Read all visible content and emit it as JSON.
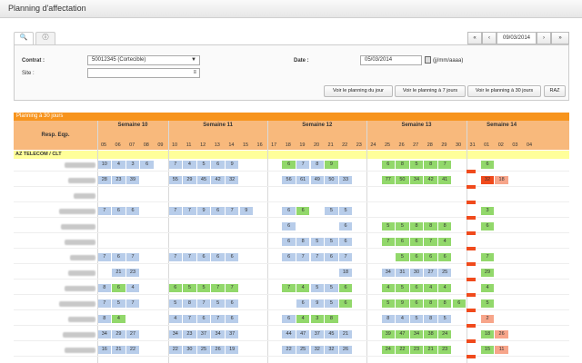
{
  "window": {
    "title": "Planning d'affectation"
  },
  "tabs": [
    {
      "icon": "search-icon",
      "glyph": "🔍"
    },
    {
      "icon": "info-icon",
      "glyph": "ⓘ"
    }
  ],
  "pager": {
    "first": "«",
    "prev": "‹",
    "date": "09/03/2014",
    "next": "›",
    "last": "»"
  },
  "form": {
    "contrat_label": "Contrat :",
    "contrat_value": "50012345 (Cortecible)",
    "site_label": "Site :",
    "date_label": "Date :",
    "date_value": "05/03/2014",
    "date_format": "(jj/mm/aaaa)"
  },
  "buttons": {
    "jour": "Voir le planning du jour",
    "sept": "Voir le planning à 7 jours",
    "trente": "Voir le planning à 30 jours",
    "raz": "RAZ"
  },
  "grid": {
    "header": "Planning à 30 jours",
    "resp_label": "Resp. Eqp.",
    "group": "AZ TELECOM / CLT",
    "weeks": [
      {
        "label": "Semaine 10"
      },
      {
        "label": "Semaine 11"
      },
      {
        "label": "Semaine 12"
      },
      {
        "label": "Semaine 13"
      },
      {
        "label": "Semaine 14"
      }
    ],
    "days": [
      "05",
      "06",
      "07",
      "08",
      "09",
      "10",
      "11",
      "12",
      "13",
      "14",
      "15",
      "16",
      "17",
      "18",
      "19",
      "20",
      "21",
      "22",
      "23",
      "24",
      "25",
      "26",
      "27",
      "28",
      "29",
      "30",
      "31",
      "01",
      "02",
      "03",
      "04"
    ],
    "colors": {
      "blue": "#b8cdea",
      "green": "#92d86b",
      "red": "#f04a1c",
      "salmon": "#f7a58a"
    },
    "rows": [
      {
        "name_w": 34,
        "cells": {
          "0": "10b",
          "1": "4b",
          "2": "3b",
          "3": "6b",
          "5": "7b",
          "6": "4b",
          "7": "5b",
          "8": "6b",
          "9": "9b",
          "13": "6g",
          "14": "7b",
          "15": "8b",
          "16": "9g",
          "20": "6g",
          "21": "8g",
          "22": "5g",
          "23": "8g",
          "24": "7g",
          "27": "6g"
        }
      },
      {
        "name_w": 30,
        "cells": {
          "0": "28b",
          "1": "23b",
          "2": "39b",
          "5": "55b",
          "6": "29b",
          "7": "45b",
          "8": "42b",
          "9": "32b",
          "13": "56b",
          "14": "61b",
          "15": "49b",
          "16": "50b",
          "17": "33b",
          "20": "77g",
          "21": "50g",
          "22": "34g",
          "23": "42g",
          "24": "41g",
          "27": "32r",
          "28": "18s"
        }
      },
      {
        "name_w": 24,
        "cells": {}
      },
      {
        "name_w": 40,
        "cells": {
          "0": "7b",
          "1": "6b",
          "2": "6b",
          "5": "7b",
          "6": "7b",
          "7": "9b",
          "8": "6b",
          "9": "7b",
          "10": "9b",
          "13": "6b",
          "14": "6g",
          "16": "5b",
          "17": "5b",
          "27": "3g"
        }
      },
      {
        "name_w": 38,
        "cells": {
          "13": "6b",
          "17": "6b",
          "20": "5g",
          "21": "5g",
          "22": "8g",
          "23": "8g",
          "24": "8g",
          "27": "6g"
        }
      },
      {
        "name_w": 34,
        "cells": {
          "13": "6b",
          "14": "8b",
          "15": "5b",
          "16": "5b",
          "17": "6b",
          "20": "7g",
          "21": "6g",
          "22": "6g",
          "23": "7g",
          "24": "4g"
        }
      },
      {
        "name_w": 28,
        "cells": {
          "0": "7b",
          "1": "6b",
          "2": "7b",
          "5": "7b",
          "6": "7b",
          "7": "6b",
          "8": "6b",
          "9": "6b",
          "13": "6b",
          "14": "7b",
          "15": "7b",
          "16": "6b",
          "17": "7b",
          "21": "5g",
          "22": "6g",
          "23": "6g",
          "24": "6g",
          "27": "7g"
        }
      },
      {
        "name_w": 30,
        "cells": {
          "1": "21b",
          "2": "23b",
          "17": "18b",
          "20": "34b",
          "21": "31b",
          "22": "30b",
          "23": "27b",
          "24": "25b",
          "27": "29g"
        }
      },
      {
        "name_w": 34,
        "cells": {
          "0": "8b",
          "1": "6g",
          "2": "4b",
          "5": "6g",
          "6": "5g",
          "7": "5g",
          "8": "7g",
          "9": "7g",
          "13": "7g",
          "14": "4g",
          "15": "5b",
          "16": "5b",
          "17": "6g",
          "20": "4g",
          "21": "5g",
          "22": "6g",
          "23": "4g",
          "24": "4g",
          "27": "4g"
        }
      },
      {
        "name_w": 40,
        "cells": {
          "0": "7b",
          "1": "5b",
          "2": "7b",
          "5": "5b",
          "6": "8b",
          "7": "7b",
          "8": "5b",
          "9": "6b",
          "14": "6b",
          "15": "9b",
          "16": "5b",
          "17": "6g",
          "20": "5g",
          "21": "9g",
          "22": "6g",
          "23": "8g",
          "24": "8g",
          "25": "6g",
          "27": "5g"
        }
      },
      {
        "name_w": 30,
        "cells": {
          "0": "8b",
          "1": "4g",
          "5": "4b",
          "6": "7b",
          "7": "6b",
          "8": "7b",
          "9": "6b",
          "13": "6b",
          "14": "4g",
          "15": "3g",
          "16": "8g",
          "20": "8b",
          "21": "4b",
          "22": "5b",
          "23": "8b",
          "24": "5b",
          "27": "2s"
        }
      },
      {
        "name_w": 36,
        "cells": {
          "0": "34b",
          "1": "29b",
          "2": "27b",
          "5": "34b",
          "6": "23b",
          "7": "37b",
          "8": "34b",
          "9": "37b",
          "13": "44b",
          "14": "47b",
          "15": "37b",
          "16": "45b",
          "17": "21b",
          "20": "39g",
          "21": "47g",
          "22": "34g",
          "23": "38g",
          "24": "24g",
          "27": "18g",
          "28": "26s"
        }
      },
      {
        "name_w": 34,
        "cells": {
          "0": "16b",
          "1": "21b",
          "2": "22b",
          "5": "22b",
          "6": "30b",
          "7": "25b",
          "8": "26b",
          "9": "19b",
          "13": "22b",
          "14": "25b",
          "15": "32b",
          "16": "32b",
          "17": "26b",
          "20": "24g",
          "21": "22g",
          "22": "23g",
          "23": "21g",
          "24": "23g",
          "27": "15g",
          "28": "11s"
        }
      }
    ]
  }
}
